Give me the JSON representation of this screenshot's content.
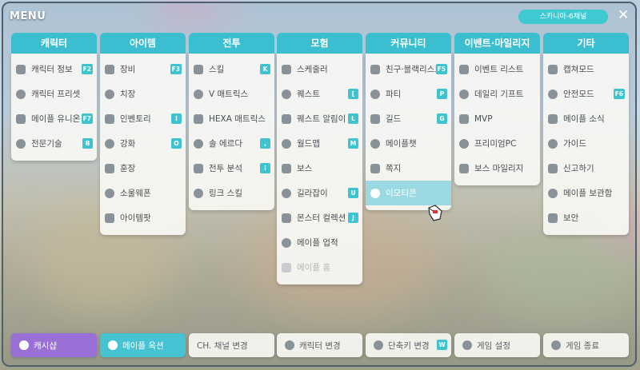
{
  "header": {
    "title": "MENU",
    "channel": "스카니아-6채널",
    "close_glyph": "✕"
  },
  "columns": [
    {
      "title": "캐릭터",
      "items": [
        {
          "label": "캐릭터 정보",
          "key": "F2",
          "icon": "user-icon"
        },
        {
          "label": "캐릭터 프리셋",
          "key": "",
          "icon": "preset-icon"
        },
        {
          "label": "메이플 유니온",
          "key": "F7",
          "icon": "union-icon"
        },
        {
          "label": "전문기술",
          "key": "B",
          "icon": "tools-icon"
        }
      ]
    },
    {
      "title": "아이템",
      "items": [
        {
          "label": "장비",
          "key": "F3",
          "icon": "sword-icon"
        },
        {
          "label": "치장",
          "key": "",
          "icon": "brush-icon"
        },
        {
          "label": "인벤토리",
          "key": "I",
          "icon": "bag-icon"
        },
        {
          "label": "강화",
          "key": "O",
          "icon": "hammer-icon"
        },
        {
          "label": "훈장",
          "key": "",
          "icon": "medal-icon"
        },
        {
          "label": "소울웨폰",
          "key": "",
          "icon": "flame-icon"
        },
        {
          "label": "아이템팟",
          "key": "",
          "icon": "sprout-icon"
        }
      ]
    },
    {
      "title": "전투",
      "items": [
        {
          "label": "스킬",
          "key": "K",
          "icon": "skill-icon"
        },
        {
          "label": "V 매트릭스",
          "key": "",
          "icon": "v-icon"
        },
        {
          "label": "HEXA 매트릭스",
          "key": "",
          "icon": "hexa-icon"
        },
        {
          "label": "솔 에르다",
          "key": ",",
          "icon": "sol-icon"
        },
        {
          "label": "전투 분석",
          "key": "i",
          "icon": "analysis-icon"
        },
        {
          "label": "링크 스킬",
          "key": "",
          "icon": "link-icon"
        }
      ]
    },
    {
      "title": "모험",
      "items": [
        {
          "label": "스케줄러",
          "key": "",
          "icon": "schedule-icon"
        },
        {
          "label": "퀘스트",
          "key": "[",
          "icon": "bulb-icon"
        },
        {
          "label": "퀘스트 알림이",
          "key": "L",
          "icon": "bulb2-icon"
        },
        {
          "label": "월드맵",
          "key": "M",
          "icon": "map-icon"
        },
        {
          "label": "보스",
          "key": "",
          "icon": "boss-icon"
        },
        {
          "label": "길라잡이",
          "key": "U",
          "icon": "compass-icon"
        },
        {
          "label": "몬스터 컬렉션",
          "key": "J",
          "icon": "collection-icon"
        },
        {
          "label": "메이플 업적",
          "key": "",
          "icon": "trophy-icon"
        },
        {
          "label": "메이플 홈",
          "key": "",
          "icon": "home-icon",
          "disabled": true
        }
      ]
    },
    {
      "title": "커뮤니티",
      "items": [
        {
          "label": "친구·블랙리스트",
          "key": "F5",
          "icon": "friends-icon"
        },
        {
          "label": "파티",
          "key": "P",
          "icon": "party-icon"
        },
        {
          "label": "길드",
          "key": "G",
          "icon": "guild-icon"
        },
        {
          "label": "메이플챗",
          "key": "",
          "icon": "chat-icon"
        },
        {
          "label": "쪽지",
          "key": "",
          "icon": "mail-icon"
        },
        {
          "label": "이모티콘",
          "key": "",
          "icon": "emoji-icon",
          "active": true
        }
      ]
    },
    {
      "title": "이벤트·마일리지",
      "items": [
        {
          "label": "이벤트 리스트",
          "key": "",
          "icon": "star-icon"
        },
        {
          "label": "데일리 기프트",
          "key": "",
          "icon": "calendar-icon"
        },
        {
          "label": "MVP",
          "key": "",
          "icon": "crown-icon"
        },
        {
          "label": "프리미엄PC",
          "key": "",
          "icon": "pc-icon"
        },
        {
          "label": "보스 마일리지",
          "key": "",
          "icon": "boss-mileage-icon"
        }
      ]
    },
    {
      "title": "기타",
      "items": [
        {
          "label": "캡쳐모드",
          "key": "",
          "icon": "capture-icon"
        },
        {
          "label": "안전모드",
          "key": "F6",
          "icon": "shield-icon"
        },
        {
          "label": "메이플 소식",
          "key": "",
          "icon": "news-icon"
        },
        {
          "label": "가이드",
          "key": "",
          "icon": "info-icon"
        },
        {
          "label": "신고하기",
          "key": "",
          "icon": "warning-icon"
        },
        {
          "label": "메이플 보관함",
          "key": "",
          "icon": "storage-icon"
        },
        {
          "label": "보안",
          "key": "",
          "icon": "security-icon"
        }
      ]
    }
  ],
  "bottom": [
    {
      "label": "캐시샵",
      "key": "",
      "icon": "gift-icon",
      "style": "cash"
    },
    {
      "label": "메이플 옥션",
      "key": "",
      "icon": "scale-icon",
      "style": "auction"
    },
    {
      "label": "CH. 채널 변경",
      "key": "",
      "icon": "",
      "style": ""
    },
    {
      "label": "캐릭터 변경",
      "key": "",
      "icon": "character-change-icon",
      "style": ""
    },
    {
      "label": "단축키 변경",
      "key": "W",
      "icon": "keyboard-icon",
      "style": ""
    },
    {
      "label": "게임 설정",
      "key": "",
      "icon": "gear-icon",
      "style": ""
    },
    {
      "label": "게임 종료",
      "key": "",
      "icon": "power-icon",
      "style": ""
    }
  ]
}
